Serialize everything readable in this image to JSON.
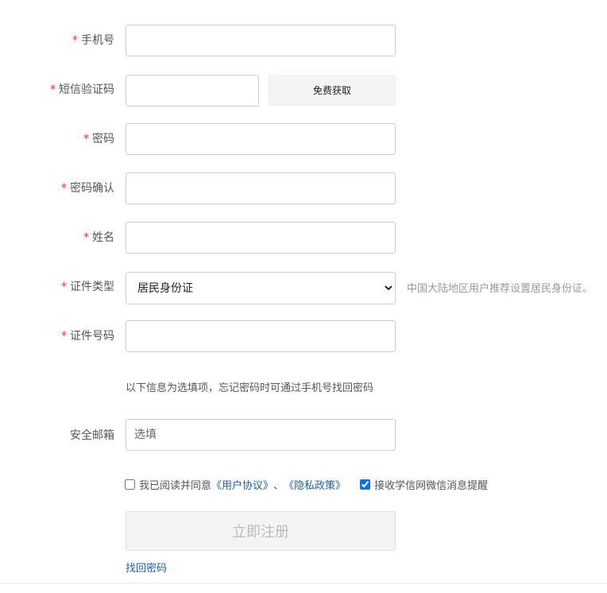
{
  "fields": [
    {
      "label": "手机号",
      "required": true
    },
    {
      "label": "短信验证码",
      "required": true
    },
    {
      "label": "密码",
      "required": true
    },
    {
      "label": "密码确认",
      "required": true
    },
    {
      "label": "姓名",
      "required": true
    },
    {
      "label": "证件类型",
      "required": true
    },
    {
      "label": "证件号码",
      "required": true
    },
    {
      "label": "安全邮箱",
      "required": false,
      "placeholder": "选填"
    }
  ],
  "required_mark": "*",
  "sms_button": "免费获取",
  "id_type": {
    "selected": "居民身份证",
    "hint": "中国大陆地区用户推荐设置居民身份证。"
  },
  "optional_info": "以下信息为选填项，忘记密码时可通过手机号找回密码",
  "agreement": {
    "prefix": "我已阅读并同意",
    "user_agreement": "《用户协议》",
    "separator": "、",
    "privacy": "《隐私政策》",
    "checked": false
  },
  "wechat": {
    "label": "接收学信网微信消息提醒",
    "checked": true
  },
  "submit": "立即注册",
  "find_password": "找回密码"
}
